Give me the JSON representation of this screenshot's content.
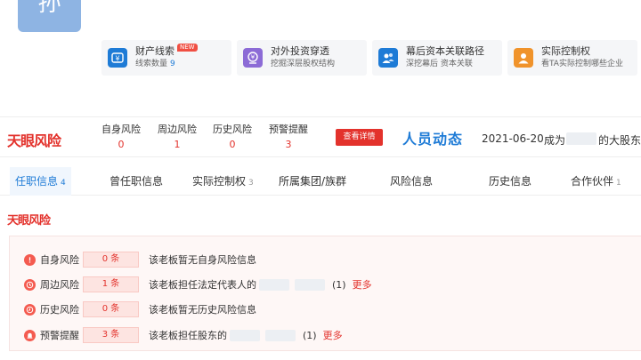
{
  "avatar": {
    "initial": "孙"
  },
  "features": [
    {
      "title": "财产线索",
      "badge": "NEW",
      "sub": "线索数量",
      "count": "9",
      "icon": "money-icon",
      "icon_bg": "#1e7bd6"
    },
    {
      "title": "对外投资穿透",
      "sub": "挖掘深层股权结构",
      "icon": "investment-icon",
      "icon_bg": "#8c6bd6"
    },
    {
      "title": "幕后资本关联路径",
      "sub": "深挖幕后 资本关联",
      "icon": "people-icon",
      "icon_bg": "#1e7bd6"
    },
    {
      "title": "实际控制权",
      "sub": "看TA实际控制哪些企业",
      "icon": "person-icon",
      "icon_bg": "#f0932b"
    }
  ],
  "risk_bar": {
    "logo": "天眼风险",
    "stats": [
      {
        "label": "自身风险",
        "value": "0"
      },
      {
        "label": "周边风险",
        "value": "1"
      },
      {
        "label": "历史风险",
        "value": "0"
      },
      {
        "label": "预警提醒",
        "value": "3"
      }
    ],
    "detail_button": "查看详情",
    "dynamics_title": "人员动态",
    "dynamics_date": "2021-06-20",
    "dynamics_prefix": "成为",
    "dynamics_suffix": "的大股东"
  },
  "tabs": [
    {
      "label": "任职信息",
      "count": "4",
      "active": true
    },
    {
      "label": "曾任职信息",
      "count": ""
    },
    {
      "label": "实际控制权",
      "count": "3"
    },
    {
      "label": "所属集团/族群",
      "count": ""
    },
    {
      "label": "风险信息",
      "count": ""
    },
    {
      "label": "历史信息",
      "count": ""
    },
    {
      "label": "合作伙伴",
      "count": "1"
    }
  ],
  "risk_section": {
    "logo": "天眼风险",
    "rows": [
      {
        "label": "自身风险",
        "count": "0 条",
        "desc": "该老板暂无自身风险信息",
        "icon": "warning-icon"
      },
      {
        "label": "周边风险",
        "count": "1 条",
        "desc": "该老板担任法定代表人的",
        "paren": "(1)",
        "more": "更多",
        "icon": "clock-icon"
      },
      {
        "label": "历史风险",
        "count": "0 条",
        "desc": "该老板暂无历史风险信息",
        "icon": "history-icon"
      },
      {
        "label": "预警提醒",
        "count": "3 条",
        "desc": "该老板担任股东的",
        "paren": "(1)",
        "more": "更多",
        "icon": "alarm-icon"
      }
    ]
  },
  "colors": {
    "brand_red": "#e3322c",
    "brand_blue": "#1e7bd6"
  }
}
